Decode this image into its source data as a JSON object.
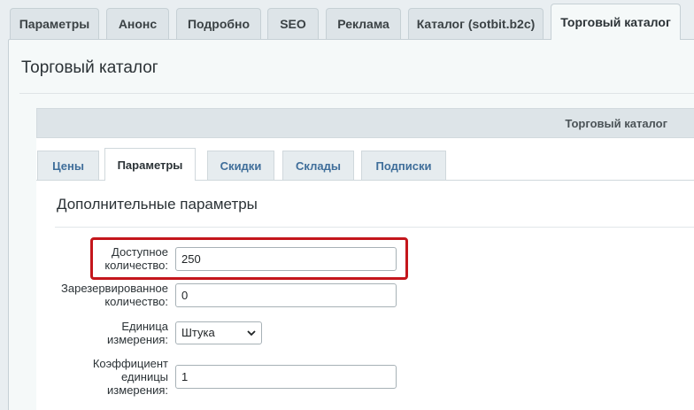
{
  "top_tabs": [
    {
      "label": "Параметры"
    },
    {
      "label": "Анонс"
    },
    {
      "label": "Подробно"
    },
    {
      "label": "SEO"
    },
    {
      "label": "Реклама"
    },
    {
      "label": "Каталог (sotbit.b2c)"
    },
    {
      "label": "Торговый каталог"
    }
  ],
  "page_title": "Торговый каталог",
  "inner_header": "Торговый каталог",
  "sub_tabs": [
    {
      "label": "Цены"
    },
    {
      "label": "Параметры"
    },
    {
      "label": "Скидки"
    },
    {
      "label": "Склады"
    },
    {
      "label": "Подписки"
    }
  ],
  "section_title": "Дополнительные параметры",
  "fields": {
    "available": {
      "label_line1": "Доступное",
      "label_line2": "количество:",
      "value": "250"
    },
    "reserved": {
      "label_line1": "Зарезервированное",
      "label_line2": "количество:",
      "value": "0"
    },
    "unit": {
      "label_line1": "Единица",
      "label_line2": "измерения:",
      "value": "Штука"
    },
    "coefficient": {
      "label_line1": "Коэффициент",
      "label_line2": "единицы",
      "label_line3": "измерения:",
      "value": "1"
    }
  },
  "colors": {
    "highlight": "#c4161c",
    "tab_link": "#3f6e9a"
  }
}
